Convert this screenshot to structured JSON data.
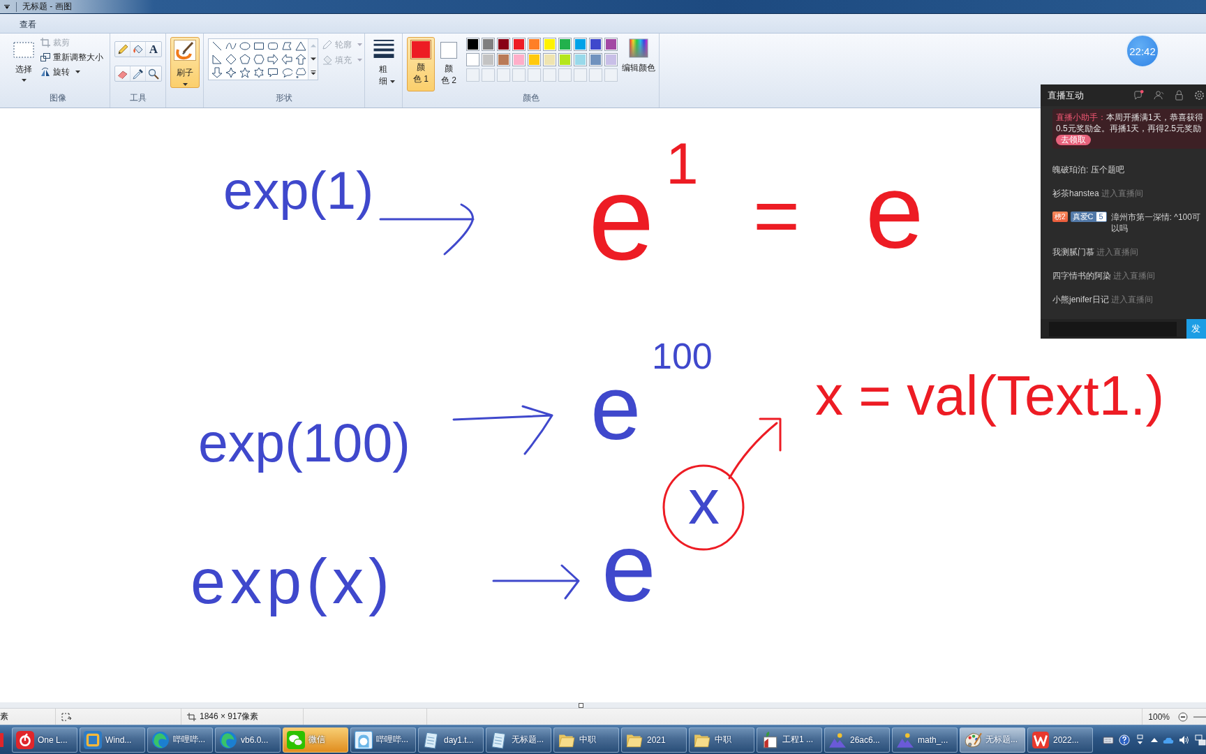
{
  "window": {
    "title": "无标题 - 画图"
  },
  "tabs": [
    {
      "label": "查看",
      "selected": false
    }
  ],
  "ribbon": {
    "image": {
      "label": "图像",
      "select": {
        "label": "选择",
        "selected": false
      },
      "actions": [
        {
          "label": "裁剪",
          "disabled": true
        },
        {
          "label": "重新调整大小",
          "disabled": false
        },
        {
          "label": "旋转",
          "disabled": false
        }
      ]
    },
    "tools": {
      "label": "工具",
      "items": [
        {
          "kind": "icon",
          "selected": false
        },
        {
          "kind": "icon",
          "selected": false
        },
        {
          "kind": "glyph",
          "label": "A",
          "selected": false
        },
        {
          "kind": "icon",
          "selected": false
        },
        {
          "kind": "icon",
          "selected": false
        },
        {
          "kind": "icon",
          "selected": false
        }
      ]
    },
    "brush": {
      "label": "刷子",
      "selected": true
    },
    "shapes": {
      "label": "形状",
      "outline": {
        "label": "轮廓",
        "disabled": true
      },
      "fill": {
        "label": "填充",
        "disabled": true
      }
    },
    "size": {
      "label": "粗细"
    },
    "colors": {
      "label": "颜色",
      "slots": [
        {
          "label": "颜色 1",
          "color": "#ed1c24",
          "selected": true
        },
        {
          "label": "颜色 2",
          "color": "#ffffff",
          "selected": false
        }
      ],
      "palette": [
        {
          "color": "#000000"
        },
        {
          "color": "#7f7f7f"
        },
        {
          "color": "#880015"
        },
        {
          "color": "#ed1c24"
        },
        {
          "color": "#ff7f27"
        },
        {
          "color": "#fff200"
        },
        {
          "color": "#22b14c"
        },
        {
          "color": "#00a2e8"
        },
        {
          "color": "#3f48cc"
        },
        {
          "color": "#a349a4"
        },
        {
          "color": "#ffffff"
        },
        {
          "color": "#c3c3c3"
        },
        {
          "color": "#b97a57"
        },
        {
          "color": "#ffaec9"
        },
        {
          "color": "#ffc90e"
        },
        {
          "color": "#efe4b0"
        },
        {
          "color": "#b5e61d"
        },
        {
          "color": "#99d9ea"
        },
        {
          "color": "#7092be"
        },
        {
          "color": "#c8bfe7"
        }
      ],
      "edit": {
        "label": "编辑颜色"
      }
    }
  },
  "floating_clock": {
    "time": "22:42"
  },
  "live_panel": {
    "title": "直播互动",
    "notice": {
      "sender": "直播小助手：",
      "text": "本周开播满1天，恭喜获得0.5元奖励金。再播1天，再得2.5元奖励",
      "button": "去领取"
    },
    "messages": [
      {
        "kind": "chat",
        "text": "魄破珀泊: 压个题吧"
      },
      {
        "kind": "entry",
        "user": "衫茶hanstea",
        "action": "进入直播间"
      },
      {
        "kind": "chat",
        "badges": [
          {
            "kind": "rank",
            "label": "榜2"
          },
          {
            "kind": "fan",
            "label": "真爱C",
            "number": "5"
          }
        ],
        "text": "漳州市第一深情: ^100可以吗"
      },
      {
        "kind": "entry",
        "user": "我测腻门慕",
        "action": "进入直播间"
      },
      {
        "kind": "entry",
        "user": "四字情书的阿染",
        "action": "进入直播间"
      },
      {
        "kind": "entry",
        "user": "小熊jenifer日记",
        "action": "进入直播间"
      }
    ],
    "send_button": "发"
  },
  "canvas": {
    "marks": [
      {
        "kind": "text",
        "text": "exp(1)",
        "color": "#3f48cc"
      },
      {
        "kind": "arrow",
        "color": "#3f48cc"
      },
      {
        "kind": "text",
        "text": "e",
        "color": "#ed1c24"
      },
      {
        "kind": "text",
        "text": "1",
        "color": "#ed1c24"
      },
      {
        "kind": "text",
        "text": "=",
        "color": "#ed1c24"
      },
      {
        "kind": "text",
        "text": "e",
        "color": "#ed1c24"
      },
      {
        "kind": "text",
        "text": "exp(100)",
        "color": "#3f48cc"
      },
      {
        "kind": "arrow",
        "color": "#3f48cc"
      },
      {
        "kind": "text",
        "text": "e",
        "color": "#3f48cc"
      },
      {
        "kind": "text",
        "text": "100",
        "color": "#3f48cc"
      },
      {
        "kind": "arrow",
        "color": "#ed1c24"
      },
      {
        "kind": "text",
        "text": "x = val(Text1.)",
        "color": "#ed1c24"
      },
      {
        "kind": "text",
        "text": "exp(x)",
        "color": "#3f48cc"
      },
      {
        "kind": "arrow",
        "color": "#3f48cc"
      },
      {
        "kind": "text",
        "text": "e",
        "color": "#3f48cc"
      },
      {
        "kind": "circle",
        "color": "#ed1c24"
      },
      {
        "kind": "text",
        "text": "x",
        "color": "#3f48cc"
      }
    ]
  },
  "status_bar": {
    "fragment": "素",
    "dimensions": "1846 × 917像素",
    "zoom": "100%"
  },
  "taskbar": {
    "items": [
      {
        "label": "One L...",
        "selected": false,
        "attention": false
      },
      {
        "label": "Wind...",
        "selected": false,
        "attention": false
      },
      {
        "label": "哔哩哔...",
        "selected": false,
        "attention": false
      },
      {
        "label": "vb6.0...",
        "selected": false,
        "attention": false
      },
      {
        "label": "微信",
        "selected": false,
        "attention": true
      },
      {
        "label": "哔哩哔...",
        "selected": false,
        "attention": false
      },
      {
        "label": "day1.t...",
        "selected": false,
        "attention": false
      },
      {
        "label": "无标题...",
        "selected": false,
        "attention": false
      },
      {
        "label": "中职",
        "selected": false,
        "attention": false
      },
      {
        "label": "2021",
        "selected": false,
        "attention": false
      },
      {
        "label": "中职",
        "selected": false,
        "attention": false
      },
      {
        "label": "工程1 ...",
        "selected": false,
        "attention": false
      },
      {
        "label": "26ac6...",
        "selected": false,
        "attention": false
      },
      {
        "label": "math_...",
        "selected": false,
        "attention": false
      },
      {
        "label": "无标题...",
        "selected": true,
        "attention": false
      },
      {
        "label": "2022...",
        "selected": false,
        "attention": false
      }
    ]
  }
}
